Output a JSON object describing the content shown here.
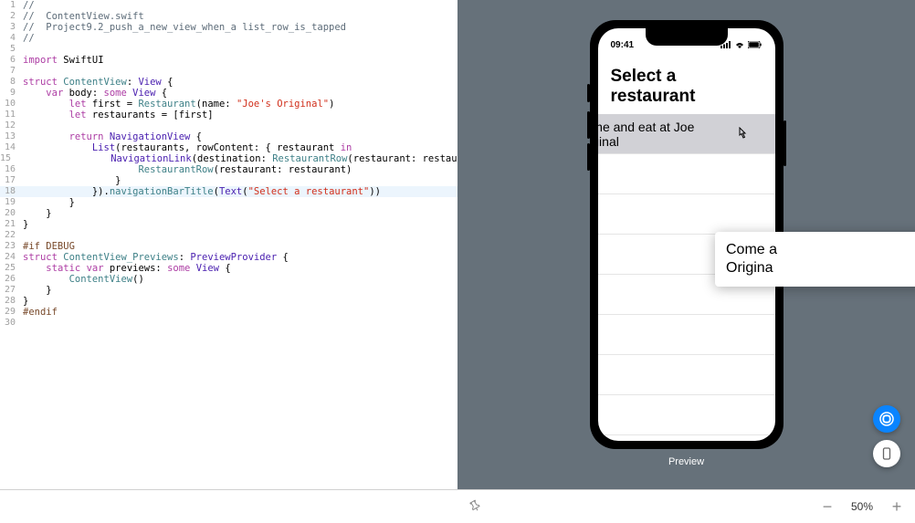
{
  "code": {
    "lines": [
      {
        "num": 1,
        "tokens": [
          {
            "t": "//",
            "c": "cmt"
          }
        ]
      },
      {
        "num": 2,
        "tokens": [
          {
            "t": "//  ContentView.swift",
            "c": "cmt"
          }
        ]
      },
      {
        "num": 3,
        "tokens": [
          {
            "t": "//  Project9.2_push_a_new_view_when_a list_row_is_tapped",
            "c": "cmt"
          }
        ]
      },
      {
        "num": 4,
        "tokens": [
          {
            "t": "//",
            "c": "cmt"
          }
        ]
      },
      {
        "num": 5,
        "tokens": []
      },
      {
        "num": 6,
        "tokens": [
          {
            "t": "import",
            "c": "kw"
          },
          {
            "t": " SwiftUI",
            "c": ""
          }
        ]
      },
      {
        "num": 7,
        "tokens": []
      },
      {
        "num": 8,
        "tokens": [
          {
            "t": "struct",
            "c": "kw"
          },
          {
            "t": " ",
            "c": ""
          },
          {
            "t": "ContentView",
            "c": "typ2"
          },
          {
            "t": ": ",
            "c": ""
          },
          {
            "t": "View",
            "c": "typ"
          },
          {
            "t": " {",
            "c": ""
          }
        ]
      },
      {
        "num": 9,
        "tokens": [
          {
            "t": "    ",
            "c": ""
          },
          {
            "t": "var",
            "c": "kw"
          },
          {
            "t": " body: ",
            "c": ""
          },
          {
            "t": "some",
            "c": "kw"
          },
          {
            "t": " ",
            "c": ""
          },
          {
            "t": "View",
            "c": "typ"
          },
          {
            "t": " {",
            "c": ""
          }
        ]
      },
      {
        "num": 10,
        "tokens": [
          {
            "t": "        ",
            "c": ""
          },
          {
            "t": "let",
            "c": "kw"
          },
          {
            "t": " first = ",
            "c": ""
          },
          {
            "t": "Restaurant",
            "c": "typ2"
          },
          {
            "t": "(name: ",
            "c": ""
          },
          {
            "t": "\"Joe's Original\"",
            "c": "str"
          },
          {
            "t": ")",
            "c": ""
          }
        ]
      },
      {
        "num": 11,
        "tokens": [
          {
            "t": "        ",
            "c": ""
          },
          {
            "t": "let",
            "c": "kw"
          },
          {
            "t": " restaurants = [first]",
            "c": ""
          }
        ]
      },
      {
        "num": 12,
        "tokens": []
      },
      {
        "num": 13,
        "tokens": [
          {
            "t": "        ",
            "c": ""
          },
          {
            "t": "return",
            "c": "kw"
          },
          {
            "t": " ",
            "c": ""
          },
          {
            "t": "NavigationView",
            "c": "typ"
          },
          {
            "t": " {",
            "c": ""
          }
        ]
      },
      {
        "num": 14,
        "tokens": [
          {
            "t": "            ",
            "c": ""
          },
          {
            "t": "List",
            "c": "typ"
          },
          {
            "t": "(restaurants, rowContent: { restaurant ",
            "c": ""
          },
          {
            "t": "in",
            "c": "kw"
          }
        ]
      },
      {
        "num": 15,
        "tokens": [
          {
            "t": "                ",
            "c": ""
          },
          {
            "t": "NavigationLink",
            "c": "typ"
          },
          {
            "t": "(destination: ",
            "c": ""
          },
          {
            "t": "RestaurantRow",
            "c": "typ2"
          },
          {
            "t": "(restaurant: restaurant)) {",
            "c": ""
          }
        ]
      },
      {
        "num": 16,
        "tokens": [
          {
            "t": "                    ",
            "c": ""
          },
          {
            "t": "RestaurantRow",
            "c": "typ2"
          },
          {
            "t": "(restaurant: restaurant)",
            "c": ""
          }
        ]
      },
      {
        "num": 17,
        "tokens": [
          {
            "t": "                }",
            "c": ""
          }
        ]
      },
      {
        "num": 18,
        "hl": true,
        "tokens": [
          {
            "t": "            }).",
            "c": ""
          },
          {
            "t": "navigationBarTitle",
            "c": "fn"
          },
          {
            "t": "(",
            "c": ""
          },
          {
            "t": "Text",
            "c": "typ"
          },
          {
            "t": "(",
            "c": ""
          },
          {
            "t": "\"Select a restaurant\"",
            "c": "str"
          },
          {
            "t": "))",
            "c": ""
          }
        ]
      },
      {
        "num": 19,
        "tokens": [
          {
            "t": "        }",
            "c": ""
          }
        ]
      },
      {
        "num": 20,
        "tokens": [
          {
            "t": "    }",
            "c": ""
          }
        ]
      },
      {
        "num": 21,
        "tokens": [
          {
            "t": "}",
            "c": ""
          }
        ]
      },
      {
        "num": 22,
        "tokens": []
      },
      {
        "num": 23,
        "tokens": [
          {
            "t": "#if DEBUG",
            "c": "preprocessor"
          }
        ]
      },
      {
        "num": 24,
        "tokens": [
          {
            "t": "struct",
            "c": "kw"
          },
          {
            "t": " ",
            "c": ""
          },
          {
            "t": "ContentView_Previews",
            "c": "typ2"
          },
          {
            "t": ": ",
            "c": ""
          },
          {
            "t": "PreviewProvider",
            "c": "typ"
          },
          {
            "t": " {",
            "c": ""
          }
        ]
      },
      {
        "num": 25,
        "tokens": [
          {
            "t": "    ",
            "c": ""
          },
          {
            "t": "static",
            "c": "kw"
          },
          {
            "t": " ",
            "c": ""
          },
          {
            "t": "var",
            "c": "kw"
          },
          {
            "t": " previews: ",
            "c": ""
          },
          {
            "t": "some",
            "c": "kw"
          },
          {
            "t": " ",
            "c": ""
          },
          {
            "t": "View",
            "c": "typ"
          },
          {
            "t": " {",
            "c": ""
          }
        ]
      },
      {
        "num": 26,
        "tokens": [
          {
            "t": "        ",
            "c": ""
          },
          {
            "t": "ContentView",
            "c": "typ2"
          },
          {
            "t": "()",
            "c": ""
          }
        ]
      },
      {
        "num": 27,
        "tokens": [
          {
            "t": "    }",
            "c": ""
          }
        ]
      },
      {
        "num": 28,
        "tokens": [
          {
            "t": "}",
            "c": ""
          }
        ]
      },
      {
        "num": 29,
        "tokens": [
          {
            "t": "#endif",
            "c": "preprocessor"
          }
        ]
      },
      {
        "num": 30,
        "tokens": []
      }
    ]
  },
  "preview": {
    "label": "Preview",
    "statusTime": "09:41",
    "navTitle": "Select a restaurant",
    "rowLine1": "ome and eat at Joe",
    "rowLine2": "riginal",
    "overlayLine1": "Come a",
    "overlayLine2": "Origina"
  },
  "footer": {
    "zoomLevel": "50%"
  }
}
